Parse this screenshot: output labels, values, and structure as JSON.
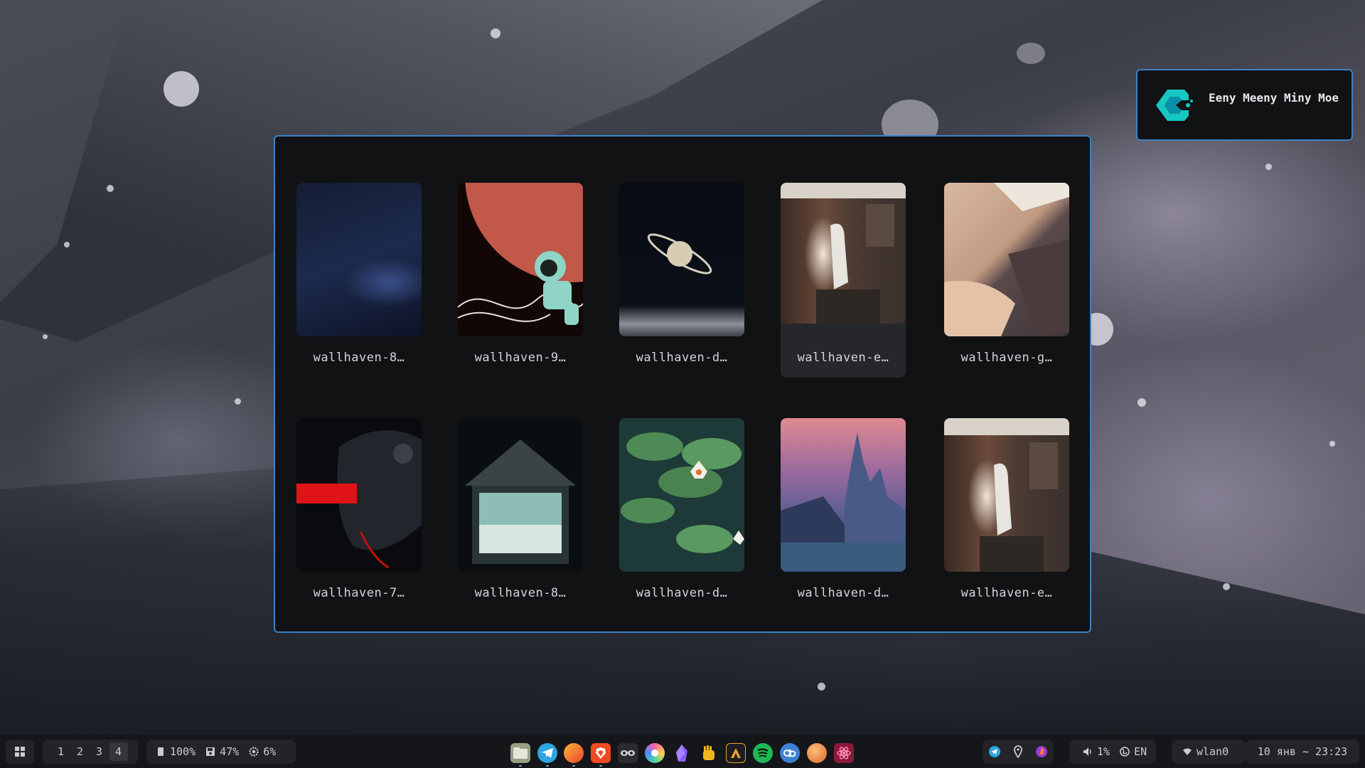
{
  "notification": {
    "title": "Eeny Meeny Miny Moe"
  },
  "launcher": {
    "items": [
      {
        "label": "wallhaven-8…",
        "thumb": "dark-blue-nebula",
        "selected": false
      },
      {
        "label": "wallhaven-9…",
        "thumb": "astronaut-red-planet",
        "selected": false
      },
      {
        "label": "wallhaven-d…",
        "thumb": "saturn-night",
        "selected": false
      },
      {
        "label": "wallhaven-e…",
        "thumb": "girl-window-room",
        "selected": true
      },
      {
        "label": "wallhaven-g…",
        "thumb": "skirt-closeup",
        "selected": false
      },
      {
        "label": "wallhaven-7…",
        "thumb": "cyber-beast-red",
        "selected": false
      },
      {
        "label": "wallhaven-8…",
        "thumb": "house-interior-night",
        "selected": false
      },
      {
        "label": "wallhaven-d…",
        "thumb": "water-lilies",
        "selected": false
      },
      {
        "label": "wallhaven-d…",
        "thumb": "castle-dusk",
        "selected": false
      },
      {
        "label": "wallhaven-e…",
        "thumb": "girl-window-room",
        "selected": false
      }
    ]
  },
  "taskbar": {
    "workspaces": [
      "1",
      "2",
      "3",
      "4"
    ],
    "active_workspace": "4",
    "battery": "100%",
    "disk": "47%",
    "cpu": "6%",
    "apps": [
      "files",
      "telegram",
      "firefox",
      "brave",
      "sunglasses",
      "chromium",
      "obsidian",
      "hand",
      "alacritty",
      "spotify",
      "qbittorrent",
      "orange-app",
      "atom"
    ],
    "tray": [
      "telegram",
      "location",
      "firefox-dev"
    ],
    "volume": "1%",
    "language": "EN",
    "network": "wlan0",
    "datetime": "10 янв ~ 23:23"
  },
  "colors": {
    "accent": "#3b82c4",
    "panel": "#111214",
    "taskbar": "#15161a"
  }
}
